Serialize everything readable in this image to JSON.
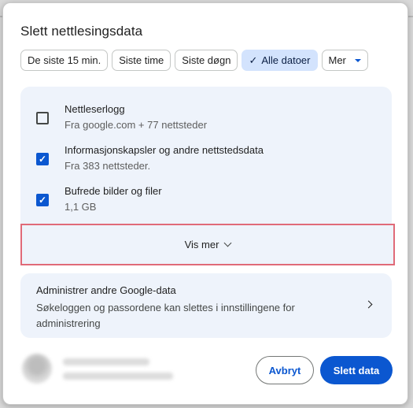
{
  "dialog": {
    "title": "Slett nettlesingsdata",
    "time_ranges": [
      {
        "label": "De siste 15 min.",
        "selected": false
      },
      {
        "label": "Siste time",
        "selected": false
      },
      {
        "label": "Siste døgn",
        "selected": false
      },
      {
        "label": "Alle datoer",
        "selected": true
      },
      {
        "label": "Mer",
        "selected": false
      }
    ],
    "items": [
      {
        "title": "Nettleserlogg",
        "subtitle": "Fra google.com + 77 nettsteder",
        "checked": false
      },
      {
        "title": "Informasjonskapsler og andre nettstedsdata",
        "subtitle": "Fra 383 nettsteder.",
        "checked": true
      },
      {
        "title": "Bufrede bilder og filer",
        "subtitle": "1,1 GB",
        "checked": true
      }
    ],
    "show_more_label": "Vis mer",
    "manage": {
      "title": "Administrer andre Google-data",
      "text": "Søkeloggen og passordene kan slettes i innstillingene for administrering"
    },
    "cancel_label": "Avbryt",
    "delete_label": "Slett data",
    "colors": {
      "accent": "#0b57d0",
      "panel": "#eef3fb",
      "selected_chip": "#d3e3fd",
      "highlight": "#e06a78"
    }
  }
}
